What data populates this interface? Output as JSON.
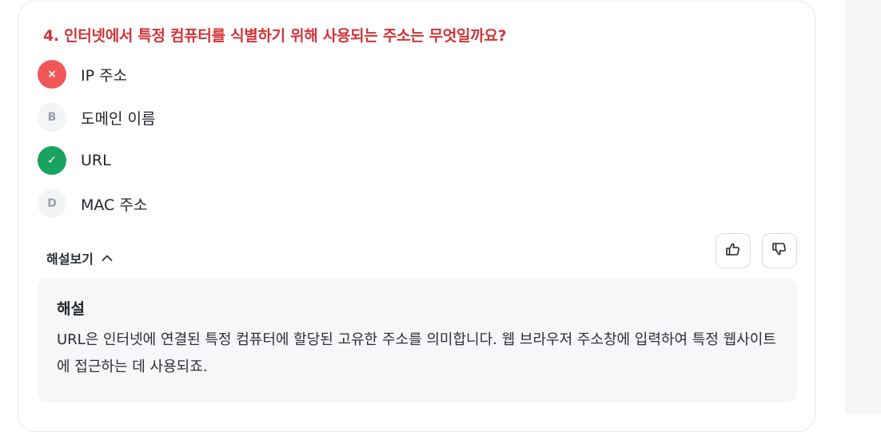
{
  "question": {
    "text": "4. 인터넷에서 특정 컴퓨터를 식별하기 위해 사용되는 주소는 무엇일까요?"
  },
  "options": [
    {
      "badge": "×",
      "label": "IP 주소",
      "state": "wrong"
    },
    {
      "badge": "B",
      "label": "도메인 이름",
      "state": "neutral"
    },
    {
      "badge": "✓",
      "label": "URL",
      "state": "correct"
    },
    {
      "badge": "D",
      "label": "MAC 주소",
      "state": "neutral"
    }
  ],
  "explanation_toggle": {
    "label": "해설보기",
    "icon": "chevron-up-icon",
    "expanded": true
  },
  "feedback": {
    "like_icon": "thumbs-up-icon",
    "dislike_icon": "thumbs-down-icon"
  },
  "explanation": {
    "title": "해설",
    "body": "URL은 인터넷에 연결된 특정 컴퓨터에 할당된 고유한 주소를 의미합니다. 웹 브라우저 주소창에 입력하여 특정 웹사이트에 접근하는 데 사용되죠."
  },
  "colors": {
    "question_red": "#d13438",
    "wrong_badge": "#f25757",
    "correct_badge": "#1aa35e",
    "panel_bg": "#f6f7f9"
  }
}
